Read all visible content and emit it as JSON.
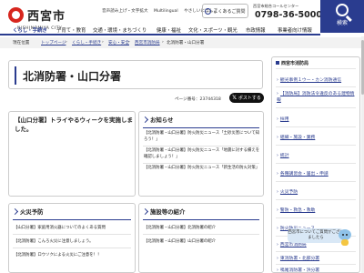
{
  "header": {
    "logo_text": "西宮市",
    "logo_sub": "NISHINOMIYA CITY",
    "top_links": [
      "音声読み上げ・文字拡大",
      "Multilingual",
      "やさしいにほんご"
    ],
    "faq_label": "よくあるご質問",
    "callcenter_label": "西宮市総合コールセンター",
    "callcenter_phone": "0798-36-5000",
    "search_label": "検索"
  },
  "gnav": [
    {
      "label": "くらし・手続き",
      "active": true
    },
    {
      "label": "子育て・教育",
      "active": false
    },
    {
      "label": "交通・環境・まちづくり",
      "active": false
    },
    {
      "label": "健康・福祉",
      "active": false
    },
    {
      "label": "文化・スポーツ・観光",
      "active": false
    },
    {
      "label": "市政情報",
      "active": false
    },
    {
      "label": "事業者向け情報",
      "active": false
    }
  ],
  "breadcrumb": {
    "now": "現在位置",
    "items": [
      "トップページ",
      "くらし・手続き",
      "安心・安全",
      "西宮市消防局"
    ],
    "current": "北消防署・山口分署"
  },
  "page": {
    "title": "北消防署・山口分署",
    "page_number": "ページ番号：23744318",
    "post_label": "ポストする"
  },
  "topic_card": {
    "text": "【山口分署】トライやるウィークを実施しました。"
  },
  "news_card": {
    "heading": "お知らせ",
    "items": [
      "【北消防署・山口分署】防火防災ニュース「土砂災害について知ろう！」",
      "【北消防署・山口分署】防火防災ニュース「地震に対する備えを確認しましょう！」",
      "【北消防署・山口分署】防火防災ニュース「新生活の防火対策」"
    ]
  },
  "fire_card": {
    "heading": "火災予防",
    "items": [
      "【山口分署】家庭用消火器についてのよくある質問",
      "【北消防署】こんろ火災に注意しましょう。",
      "【北消防署】ロウソクによる火災にご注意を！！"
    ]
  },
  "facility_card": {
    "heading": "施設等の紹介",
    "items": [
      "【北消防署・山口分署】北消防署の紹介",
      "【北消防署・山口分署】山口分署の紹介"
    ]
  },
  "sidebar": {
    "heading": "西宮市消防局",
    "links": [
      "観光事例１ウー・カン消防通信",
      "【消防局】消防法令違反のある建物情報",
      "採用",
      "組織・施設・業務",
      "統計",
      "各種講習会・届出・申請",
      "火災予防",
      "警防・救急・救助",
      "防火防災ニュース",
      "西宮市消防局",
      "東消防署・北部分署",
      "北消防署",
      "鳴尾消防署・浜分署"
    ],
    "bubble": "西宮市についてご質問がございましたら"
  }
}
